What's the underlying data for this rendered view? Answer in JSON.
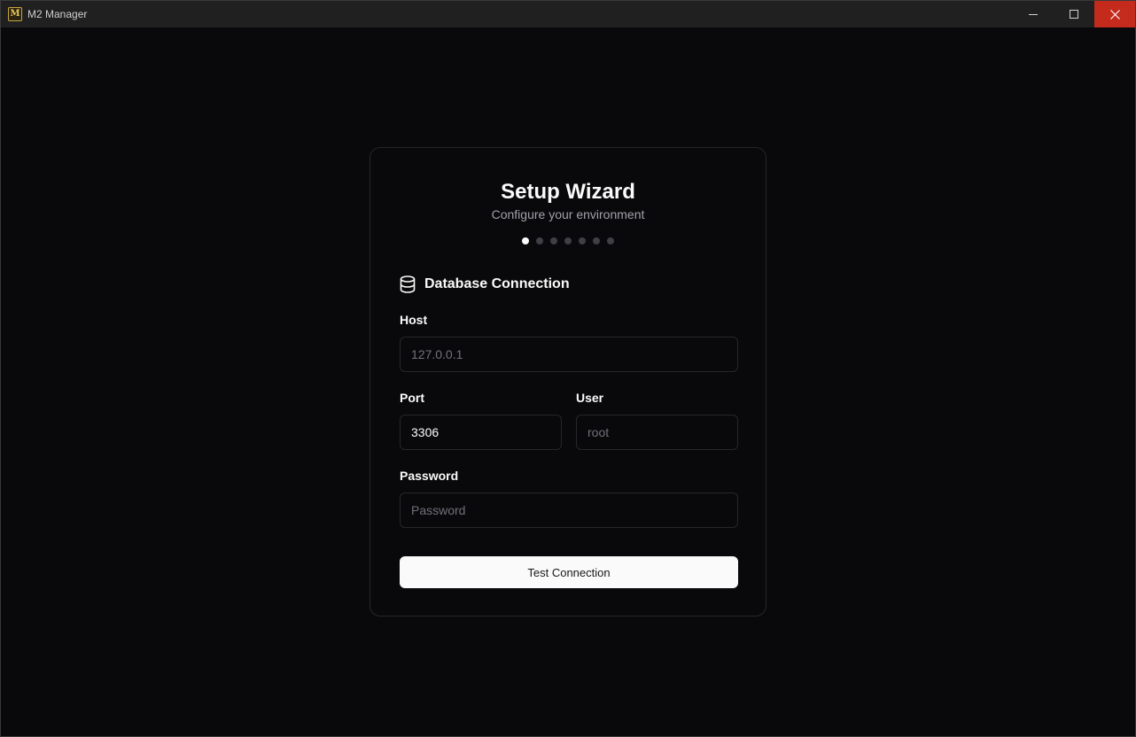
{
  "window": {
    "title": "M2 Manager",
    "icon": "m2-logo-icon",
    "controls": [
      "minimize",
      "maximize",
      "close"
    ]
  },
  "wizard": {
    "title": "Setup Wizard",
    "subtitle": "Configure your environment",
    "steps_total": 7,
    "current_step": 1
  },
  "section": {
    "icon": "database-icon",
    "title": "Database Connection"
  },
  "fields": {
    "host": {
      "label": "Host",
      "value": "",
      "placeholder": "127.0.0.1"
    },
    "port": {
      "label": "Port",
      "value": "3306",
      "placeholder": ""
    },
    "user": {
      "label": "User",
      "value": "",
      "placeholder": "root"
    },
    "password": {
      "label": "Password",
      "value": "",
      "placeholder": "Password"
    }
  },
  "actions": {
    "test_connection": "Test Connection"
  },
  "colors": {
    "background": "#09090b",
    "card_border": "#27272a",
    "primary_button": "#fafafa",
    "close_button": "#c42b1c"
  }
}
